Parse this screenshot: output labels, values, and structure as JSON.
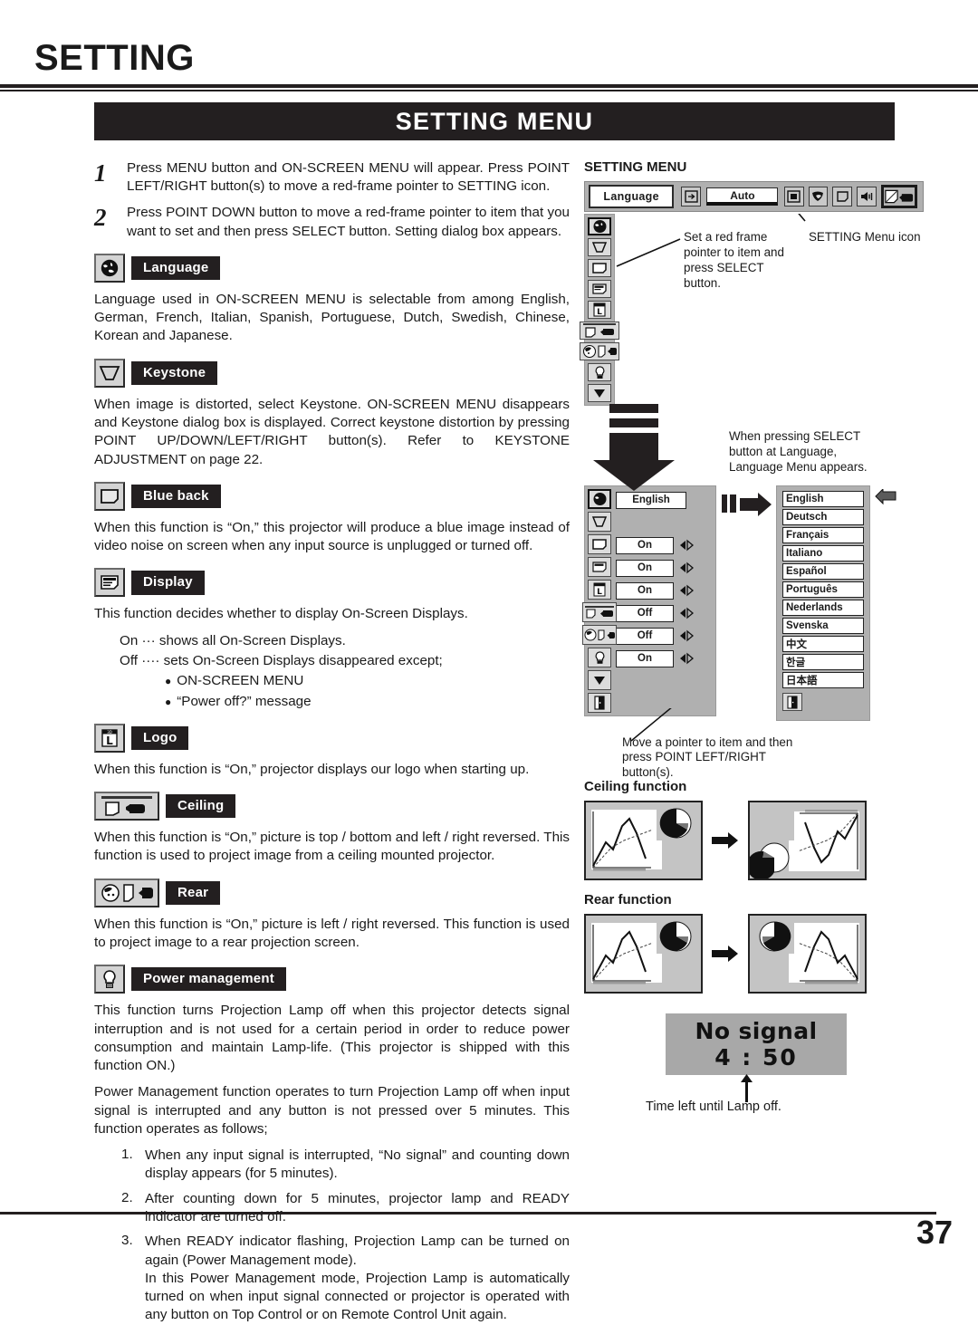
{
  "page": {
    "title": "SETTING",
    "menu_bar_title": "SETTING MENU",
    "page_number": "37"
  },
  "steps": [
    {
      "num": "1",
      "text": "Press MENU button and ON-SCREEN MENU will appear.  Press POINT LEFT/RIGHT button(s) to move a red-frame pointer to SETTING icon."
    },
    {
      "num": "2",
      "text": "Press POINT DOWN button to move a red-frame pointer to item that you want to set and then press SELECT button.  Setting dialog box appears."
    }
  ],
  "sections": {
    "language": {
      "label": "Language",
      "icon": "globe-icon",
      "body": "Language used in ON-SCREEN MENU is selectable from among English, German, French, Italian, Spanish, Portuguese, Dutch, Swedish, Chinese, Korean and Japanese."
    },
    "keystone": {
      "label": "Keystone",
      "icon": "keystone-icon",
      "body": "When image is distorted, select Keystone.  ON-SCREEN MENU disappears and Keystone dialog box is displayed.  Correct keystone distortion by pressing POINT UP/DOWN/LEFT/RIGHT button(s). Refer to KEYSTONE ADJUSTMENT on page 22."
    },
    "blue_back": {
      "label": "Blue back",
      "icon": "blue-back-icon",
      "body": "When this function is “On,” this projector will produce a blue image instead of video noise on screen when any input source is unplugged or turned off."
    },
    "display": {
      "label": "Display",
      "icon": "display-icon",
      "body": "This function decides whether to display On-Screen Displays.",
      "on_line": "On  ···  shows all On-Screen Displays.",
      "off_line": "Off ···· sets On-Screen Displays disappeared except;",
      "bullets": [
        "ON-SCREEN MENU",
        "“Power off?” message"
      ]
    },
    "logo": {
      "label": "Logo",
      "icon": "logo-icon",
      "body": "When this function is “On,” projector displays our logo when starting up."
    },
    "ceiling": {
      "label": "Ceiling",
      "icon": "ceiling-icon",
      "body": "When this function is “On,” picture is top / bottom and left / right reversed.  This function is used to project image from a ceiling mounted projector."
    },
    "rear": {
      "label": "Rear",
      "icon": "rear-icon",
      "body": "When this function is “On,” picture is left / right reversed.  This function is used to project image to a rear projection screen."
    },
    "power_management": {
      "label": "Power management",
      "icon": "lamp-icon",
      "body1": "This function turns Projection Lamp off when this projector detects signal interruption and is not used for a certain period in order to reduce power consumption and maintain Lamp-life.  (This projector is shipped with this function ON.)",
      "body2": "Power Management function operates to turn Projection Lamp off when input signal is interrupted and any button is not pressed over 5 minutes. This function operates as follows;",
      "list": [
        {
          "num": "1.",
          "text": "When any input signal is interrupted, “No signal” and counting down display appears (for 5 minutes)."
        },
        {
          "num": "2.",
          "text": "After counting down for 5 minutes, projector lamp and READY indicator are turned off."
        },
        {
          "num": "3.",
          "text": "When READY indicator flashing, Projection Lamp can be turned on again (Power Management mode)."
        }
      ],
      "list3_cont": "In this Power Management mode, Projection Lamp is automatically turned on when input signal connected or projector is operated with any button on Top Control or on Remote Control Unit again."
    }
  },
  "right": {
    "menu_heading": "SETTING MENU",
    "osd_bar": {
      "name_label": "Language",
      "auto_label": "Auto",
      "icons": [
        "input-icon",
        "screen-icon",
        "color-icon",
        "image-icon",
        "sound-icon",
        "setting-icon"
      ]
    },
    "callout_pointer": "Set a red frame pointer to item and press SELECT button.",
    "callout_menu_icon": "SETTING Menu icon",
    "callout_select": "When pressing SELECT button at Language, Language Menu appears.",
    "callout_move": "Move a pointer to item and then press POINT LEFT/RIGHT button(s).",
    "settings_panel": {
      "rows": [
        {
          "icon": "globe-icon",
          "value": "English"
        },
        {
          "icon": "keystone-icon",
          "value": ""
        },
        {
          "icon": "blue-back-icon",
          "value": "On"
        },
        {
          "icon": "display-icon",
          "value": "On"
        },
        {
          "icon": "logo-icon",
          "value": "On"
        },
        {
          "icon": "ceiling-icon",
          "value": "Off"
        },
        {
          "icon": "rear-icon",
          "value": "Off"
        },
        {
          "icon": "lamp-icon",
          "value": "On"
        }
      ]
    },
    "language_menu": [
      "English",
      "Deutsch",
      "Français",
      "Italiano",
      "Español",
      "Português",
      "Nederlands",
      "Svenska",
      "中文",
      "한글",
      "日本語"
    ],
    "ceiling_function_title": "Ceiling function",
    "rear_function_title": "Rear function",
    "no_signal": {
      "line1": "No signal",
      "line2": "4 : 50"
    },
    "no_signal_caption": "Time left until Lamp off."
  }
}
